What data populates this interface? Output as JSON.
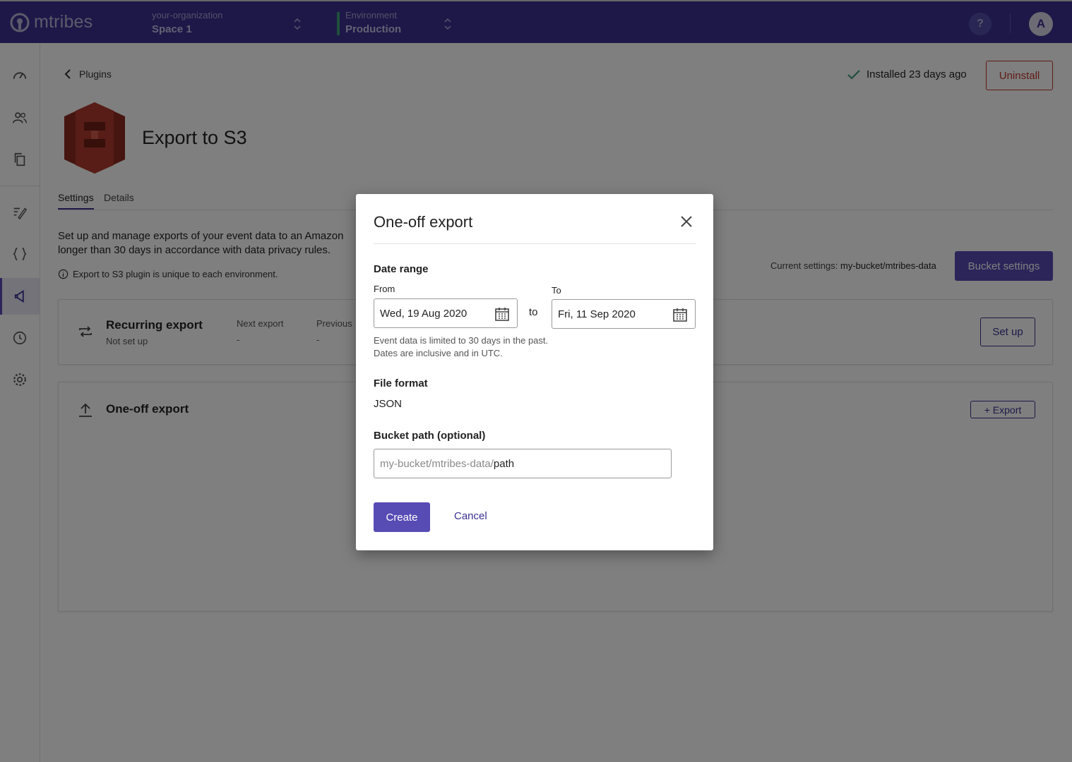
{
  "header": {
    "logo_text": "mtribes",
    "org_label": "your-organization",
    "space_name": "Space 1",
    "env_label": "Environment",
    "env_name": "Production",
    "help_label": "?",
    "avatar_initial": "A"
  },
  "sidebar": {
    "items": [
      "dashboard-icon",
      "people-icon",
      "copy-icon",
      "edit-icon",
      "code-icon",
      "plugin-icon",
      "history-icon",
      "settings-icon"
    ],
    "active_item": "plugin-icon"
  },
  "page": {
    "back_label": "Plugins",
    "installed_text": "Installed 23 days ago",
    "uninstall_label": "Uninstall",
    "title": "Export to S3",
    "tabs": [
      "Settings",
      "Details"
    ],
    "active_tab": "Settings",
    "description": "Set up and manage exports of your event data to an Amazon longer than 30 days in accordance with data privacy rules.",
    "note": "Export to S3 plugin is unique to each environment.",
    "current_settings_label": "Current settings:",
    "current_settings_value": "my-bucket/mtribes-data",
    "bucket_settings_label": "Bucket settings"
  },
  "recurring": {
    "title": "Recurring export",
    "status": "Not set up",
    "next_label": "Next export",
    "next_value": "-",
    "previous_label": "Previous",
    "previous_value": "-",
    "setup_label": "Set up"
  },
  "oneoff": {
    "title": "One-off export",
    "export_label": "+ Export"
  },
  "modal": {
    "title": "One-off export",
    "date_range_label": "Date range",
    "from_label": "From",
    "from_value": "Wed, 19 Aug 2020",
    "to_word": "to",
    "to_label": "To",
    "to_value": "Fri, 11 Sep 2020",
    "hint_line1": "Event data is limited to 30 days in the past.",
    "hint_line2": "Dates are inclusive and in UTC.",
    "file_format_label": "File format",
    "file_format_value": "JSON",
    "bucket_path_label": "Bucket path (optional)",
    "bucket_path_prefix": "my-bucket/mtribes-data/",
    "bucket_path_value": "path",
    "create_label": "Create",
    "cancel_label": "Cancel"
  },
  "colors": {
    "brand": "#3a3191",
    "accent": "#574bb4",
    "danger": "#c0392b",
    "success": "#3f9e7a",
    "s3_red": "#b03a2e"
  }
}
